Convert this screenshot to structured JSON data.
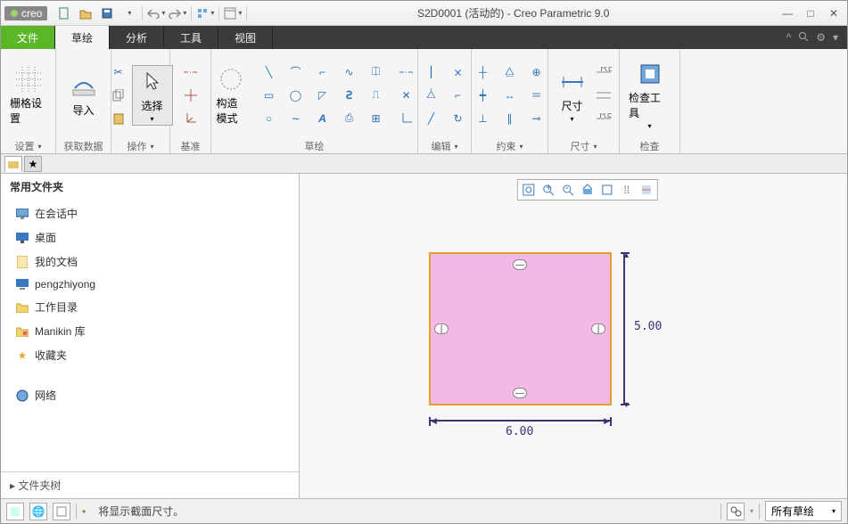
{
  "brand": "creo",
  "title": "S2D0001 (活动的) - Creo Parametric 9.0",
  "tabs": [
    "文件",
    "草绘",
    "分析",
    "工具",
    "视图"
  ],
  "ribbon": {
    "grid": {
      "btn": "栅格设置",
      "label": "设置"
    },
    "import": {
      "btn": "导入",
      "label": "获取数据"
    },
    "select": {
      "btn": "选择",
      "label": "操作"
    },
    "datum": {
      "label": "基准"
    },
    "construct": {
      "btn": "构造模式",
      "label": "草绘"
    },
    "edit": {
      "label": "编辑"
    },
    "constrain": {
      "label": "约束"
    },
    "dim": {
      "btn": "尺寸",
      "label": "尺寸"
    },
    "inspect": {
      "btn": "检查工具",
      "label": "检查"
    }
  },
  "sidebar": {
    "header": "常用文件夹",
    "items": [
      {
        "icon": "monitor",
        "label": "在会话中"
      },
      {
        "icon": "desktop",
        "label": "桌面"
      },
      {
        "icon": "docs",
        "label": "我的文档"
      },
      {
        "icon": "computer",
        "label": "pengzhiyong"
      },
      {
        "icon": "folder",
        "label": "工作目录"
      },
      {
        "icon": "manikin",
        "label": "Manikin 库"
      },
      {
        "icon": "fav",
        "label": "收藏夹"
      },
      {
        "icon": "network",
        "label": "网络"
      }
    ],
    "tree_label": "文件夹树"
  },
  "chart_data": {
    "type": "sketch",
    "width": 6.0,
    "height": 5.0,
    "width_label": "6.00",
    "height_label": "5.00",
    "constraints": [
      "horizontal",
      "horizontal",
      "vertical",
      "vertical"
    ]
  },
  "status": {
    "msg": "将显示截面尺寸。",
    "combo": "所有草绘"
  }
}
